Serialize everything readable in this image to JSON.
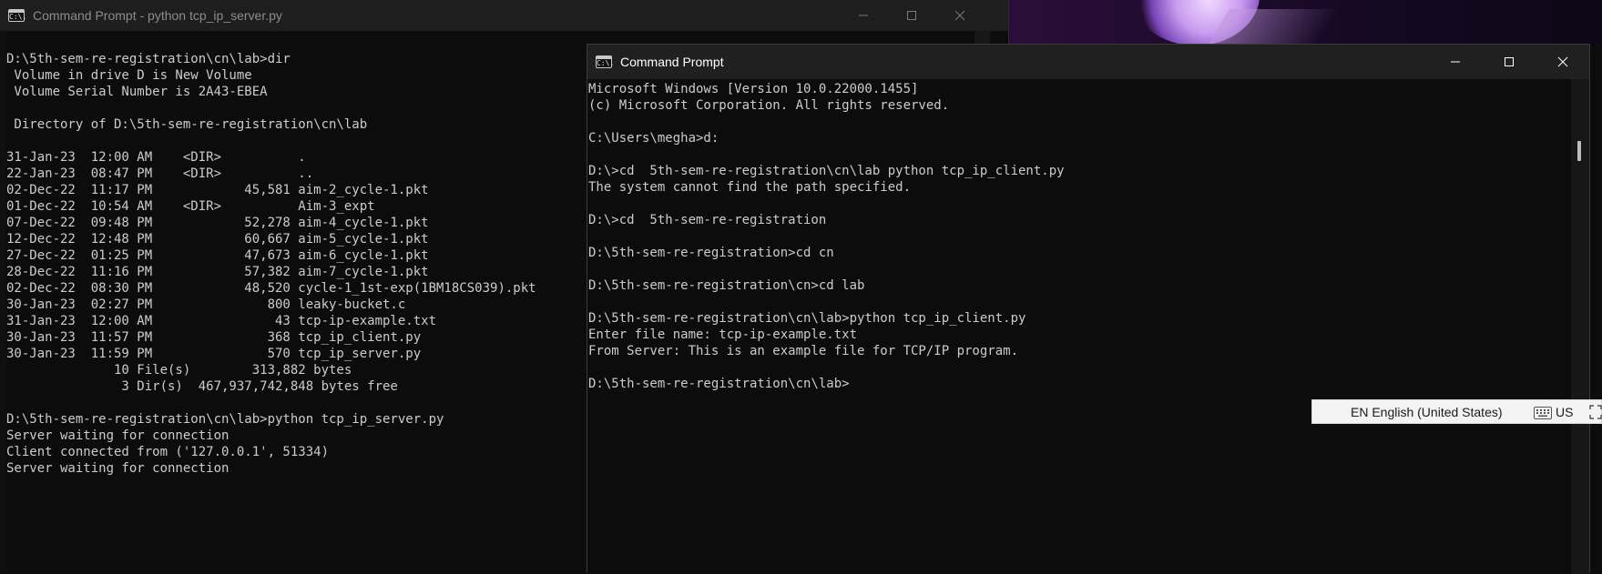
{
  "left_window": {
    "title": "Command Prompt - python  tcp_ip_server.py",
    "icon_text": "C:\\.",
    "lines": [
      "D:\\5th-sem-re-registration\\cn\\lab>dir",
      " Volume in drive D is New Volume",
      " Volume Serial Number is 2A43-EBEA",
      "",
      " Directory of D:\\5th-sem-re-registration\\cn\\lab",
      "",
      "31-Jan-23  12:00 AM    <DIR>          .",
      "22-Jan-23  08:47 PM    <DIR>          ..",
      "02-Dec-22  11:17 PM            45,581 aim-2_cycle-1.pkt",
      "01-Dec-22  10:54 AM    <DIR>          Aim-3_expt",
      "07-Dec-22  09:48 PM            52,278 aim-4_cycle-1.pkt",
      "12-Dec-22  12:48 PM            60,667 aim-5_cycle-1.pkt",
      "27-Dec-22  01:25 PM            47,673 aim-6_cycle-1.pkt",
      "28-Dec-22  11:16 PM            57,382 aim-7_cycle-1.pkt",
      "02-Dec-22  08:30 PM            48,520 cycle-1_1st-exp(1BM18CS039).pkt",
      "30-Jan-23  02:27 PM               800 leaky-bucket.c",
      "31-Jan-23  12:00 AM                43 tcp-ip-example.txt",
      "30-Jan-23  11:57 PM               368 tcp_ip_client.py",
      "30-Jan-23  11:59 PM               570 tcp_ip_server.py",
      "              10 File(s)        313,882 bytes",
      "               3 Dir(s)  467,937,742,848 bytes free",
      "",
      "D:\\5th-sem-re-registration\\cn\\lab>python tcp_ip_server.py",
      "Server waiting for connection",
      "Client connected from ('127.0.0.1', 51334)",
      "Server waiting for connection"
    ]
  },
  "right_window": {
    "title": "Command Prompt",
    "icon_text": "C:\\.",
    "lines": [
      "Microsoft Windows [Version 10.0.22000.1455]",
      "(c) Microsoft Corporation. All rights reserved.",
      "",
      "C:\\Users\\megha>d:",
      "",
      "D:\\>cd  5th-sem-re-registration\\cn\\lab python tcp_ip_client.py",
      "The system cannot find the path specified.",
      "",
      "D:\\>cd  5th-sem-re-registration",
      "",
      "D:\\5th-sem-re-registration>cd cn",
      "",
      "D:\\5th-sem-re-registration\\cn>cd lab",
      "",
      "D:\\5th-sem-re-registration\\cn\\lab>python tcp_ip_client.py",
      "Enter file name: tcp-ip-example.txt",
      "From Server: This is an example file for TCP/IP program.",
      "",
      "D:\\5th-sem-re-registration\\cn\\lab>"
    ]
  },
  "language_bar": {
    "language": "EN English (United States)",
    "keyboard_icon": "keyboard-icon",
    "layout": "US"
  },
  "colors": {
    "terminal_bg": "#0c0c0c",
    "terminal_text": "#cccccc",
    "inactive_title": "#8c8c8c",
    "active_title": "#ffffff"
  }
}
